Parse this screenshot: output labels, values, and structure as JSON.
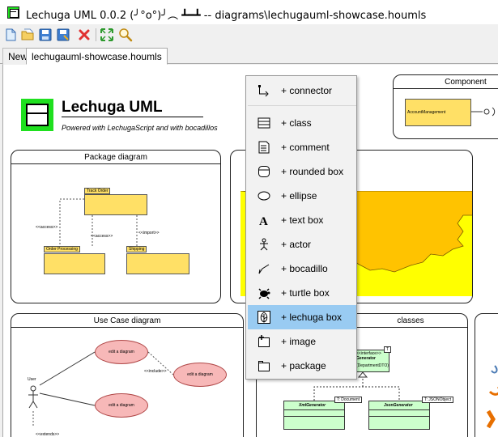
{
  "window": {
    "title": "Lechuga UML  0.0.2  (╯°o°)╯︵ ┻━┻  -- diagrams\\lechugauml-showcase.houmls"
  },
  "toolbar": {
    "buttons": [
      "new-file-icon",
      "open-folder-icon",
      "save-icon",
      "save-as-icon",
      "delete-icon",
      "fit-to-screen-icon",
      "zoom-icon"
    ]
  },
  "tabs": {
    "new_label": "New",
    "active_label": "lechugauml-showcase.houmls"
  },
  "canvas": {
    "brand": {
      "title": "Lechuga UML",
      "subtitle": "Powered with LechugaScript and with bocadillos"
    },
    "package_diagram": {
      "title": "Package diagram",
      "track_order": "Track Order",
      "order_processing": "Order Processing",
      "shipping": "Shipping",
      "access": "<<access>>",
      "access2": "<<access>>",
      "import": "<<import>>"
    },
    "component_diagram": {
      "title": "Component",
      "component": "AccountManagement"
    },
    "use_case_diagram": {
      "title": "Use Case diagram",
      "use_case_1": "edit a diagram",
      "use_case_2": "edit a diagram",
      "use_case_3": "edit a diagram",
      "actor": "User",
      "include": "<<include>>",
      "extends": "<<extends>>"
    },
    "classes_diagram": {
      "title": "classes",
      "interface": "<<interface>>",
      "generator": "Generator",
      "param": "(DepartmentDTO)",
      "t1": "T",
      "xml": "XmlGenerator",
      "json": "JsonGenerator",
      "t_document": "T: Document",
      "t_json": "T: JSONObject"
    },
    "colors": {
      "fractal_yellow": "#ffff00",
      "fractal_orange": "#ffc300",
      "uml_yellow": "#ffe066",
      "use_case_pink": "#f7b8b8",
      "class_green": "#ccffcc",
      "brand_green": "#1fe01f"
    }
  },
  "context_menu": {
    "items": [
      {
        "label": "+ connector",
        "icon": "connector-icon"
      },
      {
        "label": "+ class",
        "icon": "class-icon"
      },
      {
        "label": "+ comment",
        "icon": "comment-icon"
      },
      {
        "label": "+ rounded box",
        "icon": "rounded-box-icon"
      },
      {
        "label": "+ ellipse",
        "icon": "ellipse-icon"
      },
      {
        "label": "+ text box",
        "icon": "text-box-icon"
      },
      {
        "label": "+ actor",
        "icon": "actor-icon"
      },
      {
        "label": "+ bocadillo",
        "icon": "bocadillo-icon"
      },
      {
        "label": "+ turtle box",
        "icon": "turtle-icon"
      },
      {
        "label": "+ lechuga box",
        "icon": "lechuga-icon"
      },
      {
        "label": "+ image",
        "icon": "image-icon"
      },
      {
        "label": "+ package",
        "icon": "package-icon"
      }
    ],
    "highlighted": "+ lechuga box"
  }
}
